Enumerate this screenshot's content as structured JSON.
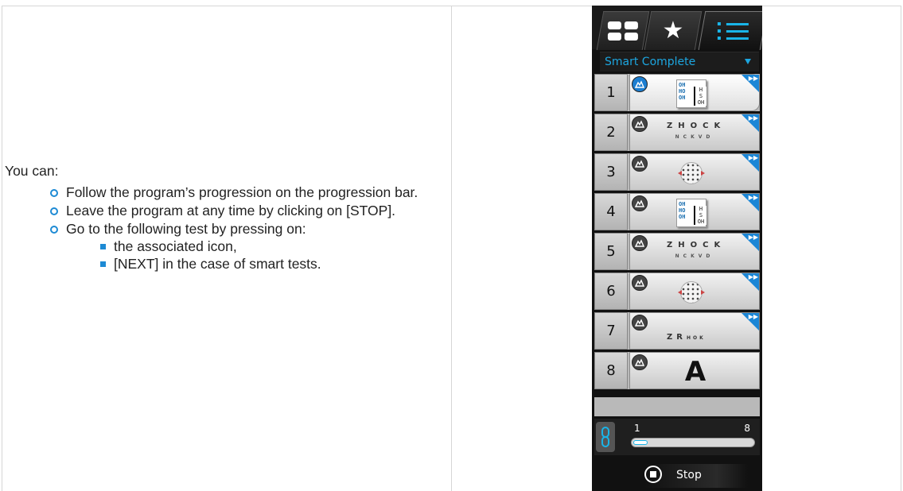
{
  "doc": {
    "intro": "You can:",
    "bullets": [
      {
        "text": "Follow the program’s progression on the progression bar."
      },
      {
        "text": "Leave the program at any time by clicking on [STOP]."
      },
      {
        "text": "Go to the following test by pressing on:",
        "sub": [
          "the associated icon,",
          "[NEXT] in the case of smart tests."
        ]
      }
    ]
  },
  "device": {
    "tabs": [
      "grid-icon",
      "star-icon",
      "list-icon"
    ],
    "active_tab": "list-icon",
    "program_name": "Smart Complete",
    "steps": [
      {
        "num": "1",
        "type": "chart",
        "active": true,
        "next": true
      },
      {
        "num": "2",
        "type": "letters",
        "row1": "ZHOCK",
        "row2": "NCKVD",
        "next": true
      },
      {
        "num": "3",
        "type": "dots",
        "next": true
      },
      {
        "num": "4",
        "type": "chart",
        "next": true
      },
      {
        "num": "5",
        "type": "letters",
        "row1": "ZHOCK",
        "row2": "NCKVD",
        "next": true
      },
      {
        "num": "6",
        "type": "dots",
        "next": true
      },
      {
        "num": "7",
        "type": "zr",
        "row1": "ZR",
        "row2": "HOK",
        "next": true
      },
      {
        "num": "8",
        "type": "bigA",
        "letter": "A",
        "next": false
      }
    ],
    "chart_text": {
      "left": "OH\nHO\nOH",
      "right": "H\nS\nOH"
    },
    "progress": {
      "start": "1",
      "end": "8",
      "fraction": 0.12
    },
    "stop_label": "Stop",
    "accent": "#1b86d6"
  }
}
